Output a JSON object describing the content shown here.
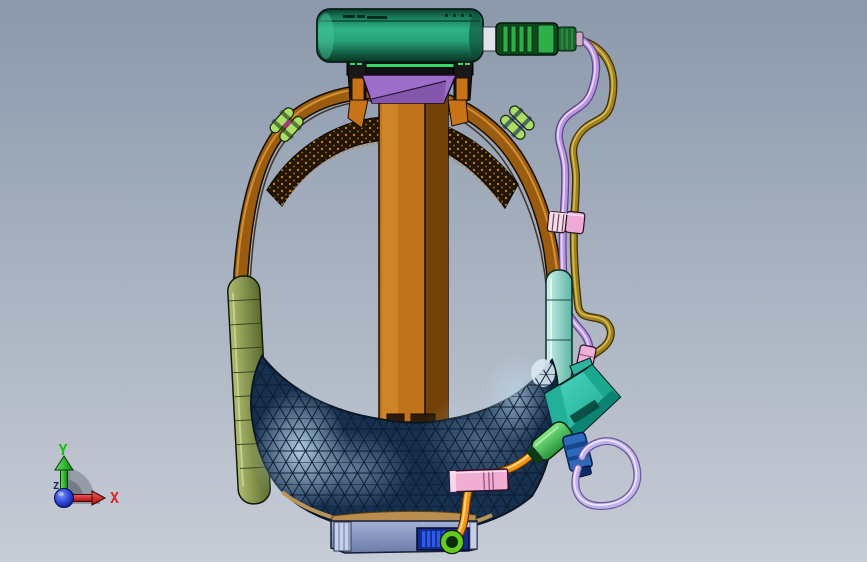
{
  "viewport": {
    "background_top": "#8b99ac",
    "background_bottom": "#c7ccd6"
  },
  "triad": {
    "x_label": "X",
    "y_label": "Y",
    "z_label": "Z",
    "x_color": "#e02424",
    "y_color": "#18c018",
    "z_color": "#0d2a56",
    "origin_color": "#2a48d8",
    "quadrant_color": "#959ca8"
  },
  "colors": {
    "battery_green": "#2fb286",
    "battery_dark": "#0b3b2b",
    "plug_ring_green": "#2fae4a",
    "plug_barrel": "#0e4a1c",
    "headband_brown": "#9a5c10",
    "headband_highlight": "#d9973a",
    "liner_black": "#221504",
    "liner_dots": "#d08a28",
    "clip_green": "#aade66",
    "front_strap_orange": "#c0731a",
    "front_strap_shadow": "#744208",
    "bracket_purple": "#9d6dca",
    "mount_black": "#101010",
    "mount_green_stripe": "#37d86a",
    "mount_orange": "#c87318",
    "left_arm_olive": "#8a9a54",
    "right_arm_teal": "#8fd8ca",
    "visor_navy": "#16304f",
    "visor_highlight": "#b8d4ea",
    "visor_rim_tan": "#b98d4e",
    "cable_gold": "#a1821c",
    "cable_purple": "#bb95e2",
    "cable_lavender": "#c0b2ec",
    "cable_orange": "#f29415",
    "cable_clip_pink": "#eeaad6",
    "visor_clip_pink": "#f2aed2",
    "device_teal": "#33cab4",
    "device_plug_green": "#46c95c",
    "device_blue": "#2e6abc",
    "device_pink_connector": "#eeb0d8",
    "base_plate_blue": "#8e9cc8",
    "base_connector_navy": "#132c92",
    "base_slot_blue": "#2e5cea",
    "ring_green": "#64cc1f"
  },
  "parts": [
    "headband-strap",
    "headband-mesh-liner",
    "strap-adjuster-clips",
    "overhead-mount",
    "battery-cylinder",
    "power-plug",
    "front-strap",
    "left-side-arm",
    "right-side-arm",
    "mesh-visor-shell",
    "cable-clip",
    "visor-cable-clip",
    "gold-cable",
    "purple-cable",
    "orange-cable",
    "lavender-cable-loop",
    "side-device-box",
    "device-green-connector",
    "device-blue-fitting",
    "device-pink-connector",
    "chin-base-plate",
    "base-connector-block",
    "cable-ring-connector",
    "orientation-triad"
  ]
}
